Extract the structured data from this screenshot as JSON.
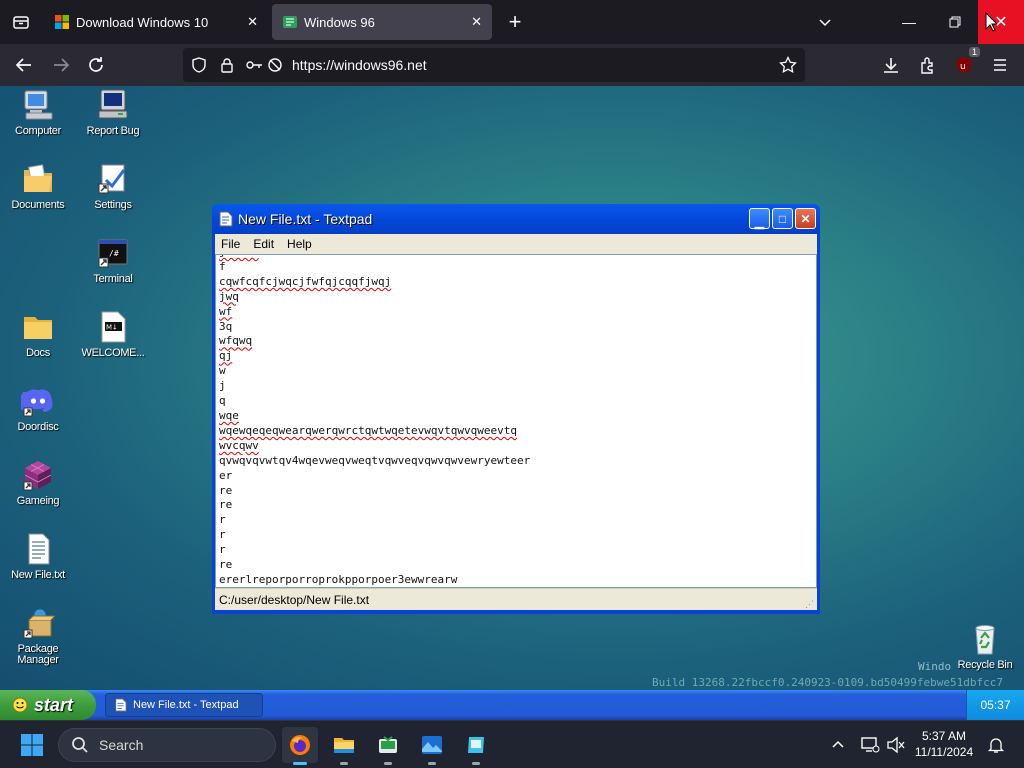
{
  "browser": {
    "tabs": [
      {
        "title": "Download Windows 10"
      },
      {
        "title": "Windows 96",
        "active": true
      }
    ],
    "url_display": "https://windows96.net",
    "extension_badge": "1"
  },
  "desktop": {
    "icons": [
      {
        "label": "Computer",
        "icon": "computer-icon"
      },
      {
        "label": "Report Bug",
        "icon": "report-bug-icon"
      },
      {
        "label": "Documents",
        "icon": "documents-icon"
      },
      {
        "label": "Settings",
        "icon": "settings-icon"
      },
      {
        "label": "Terminal",
        "icon": "terminal-icon"
      },
      {
        "label": "Docs",
        "icon": "folder-icon"
      },
      {
        "label": "WELCOME...",
        "icon": "markdown-file-icon"
      },
      {
        "label": "Doordisc",
        "icon": "discord-icon"
      },
      {
        "label": "Gameing",
        "icon": "cube-icon"
      },
      {
        "label": "New File.txt",
        "icon": "text-file-icon"
      },
      {
        "label": "Package Manager",
        "icon": "package-manager-icon"
      },
      {
        "label": "Recycle Bin",
        "icon": "recycle-bin-icon"
      }
    ],
    "watermark_line1": "Windo",
    "watermark_line2": "Build 13268.22fbccf0.240923-0109.bd50499febwe51dbfcc7"
  },
  "textpad": {
    "title": "New File.txt - Textpad",
    "menu": [
      "File",
      "Edit",
      "Help"
    ],
    "lines": [
      {
        "text": "jscwas",
        "spell": true
      },
      {
        "text": "f",
        "spell": false
      },
      {
        "text": "cqwfcqfcjwqcjfwfqjcqqfjwqj",
        "spell": true
      },
      {
        "text": "jwq",
        "spell": true
      },
      {
        "text": "wf",
        "spell": true
      },
      {
        "text": "3q",
        "spell": false
      },
      {
        "text": "wfqwq",
        "spell": true
      },
      {
        "text": "qj",
        "spell": true
      },
      {
        "text": "w",
        "spell": false
      },
      {
        "text": "j",
        "spell": false
      },
      {
        "text": "q",
        "spell": false
      },
      {
        "text": "wqe",
        "spell": true
      },
      {
        "text": "wqewqeqeqwearqwerqwrctqwtwqetevwqvtqwvqweevtq",
        "spell": true
      },
      {
        "text": "wvcqwv",
        "spell": true
      },
      {
        "text": "qvwqvqvwtqv4wqevweqvweqtvqwveqvqwvqwvewryewteer",
        "spell": false
      },
      {
        "text": "er",
        "spell": false
      },
      {
        "text": "re",
        "spell": false
      },
      {
        "text": "re",
        "spell": false
      },
      {
        "text": "r",
        "spell": false
      },
      {
        "text": "r",
        "spell": false
      },
      {
        "text": "r",
        "spell": false
      },
      {
        "text": "re",
        "spell": false
      },
      {
        "text": "ererlreporporroprokpporpoer3ewwrearw",
        "spell": false
      }
    ],
    "status_path": "C:/user/desktop/New File.txt"
  },
  "taskbar96": {
    "start_label": "start",
    "window_button": "New File.txt - Textpad",
    "clock": "05:37"
  },
  "windows_taskbar": {
    "search_placeholder": "Search",
    "time": "5:37 AM",
    "date": "11/11/2024"
  }
}
